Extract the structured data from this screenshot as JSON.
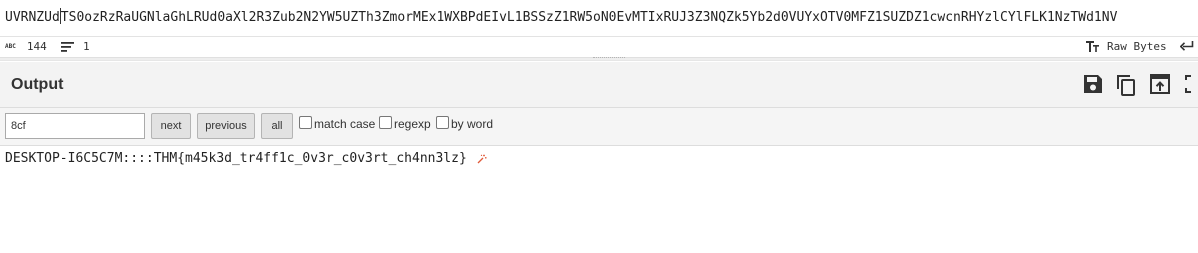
{
  "input": {
    "text_before_caret": "UVRNZUd",
    "text_after_caret": "TS0ozRzRaUGNlaGhLRUd0aXl2R3Zub2N2YW5UZTh3ZmorMEx1WXBPdEIvL1BSSzZ1RW5oN0EvMTIxRUJ3Z3NQZk5Yb2d0VUYxOTV0MFZ1SUZDZ1cwcnRHYzlCYlFLK1NzTWd1NV"
  },
  "status_bar": {
    "abc_icon_text": "ABC",
    "char_count": "144",
    "line_count": "1",
    "encoding_label": "Raw Bytes"
  },
  "output": {
    "title": "Output",
    "icons": [
      "save-icon",
      "copy-icon",
      "open-in-input-icon",
      "maximise-icon"
    ],
    "text": "DESKTOP-I6C5C7M::::THM{m45k3d_tr4ff1c_0v3r_c0v3rt_ch4nn3lz}"
  },
  "search": {
    "query": "8cf",
    "next_label": "next",
    "previous_label": "previous",
    "all_label": "all",
    "match_case_label": "match case",
    "regexp_label": "regexp",
    "by_word_label": "by word"
  },
  "colors": {
    "magic_wand": "#e05a3a",
    "header_bg": "#f3f3f3",
    "button_bg": "#e2e2e2"
  }
}
